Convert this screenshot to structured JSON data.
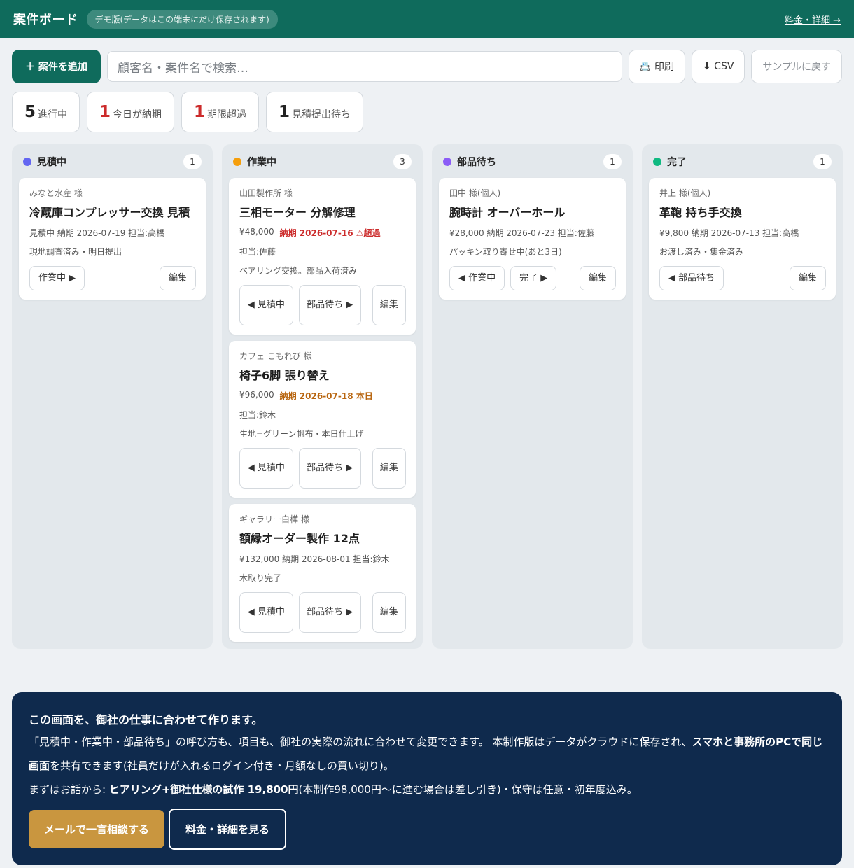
{
  "header": {
    "title": "案件ボード",
    "demo_badge": "デモ版(データはこの端末にだけ保存されます)",
    "pricing_link": "料金・詳細 →"
  },
  "toolbar": {
    "add_label": "＋ 案件を追加",
    "search_placeholder": "顧客名・案件名で検索…",
    "print_label": "印刷",
    "print_icon": "📇",
    "csv_label": "⬇ CSV",
    "sample_label": "サンプルに戻す"
  },
  "stats": [
    {
      "num": "5",
      "label": "進行中",
      "color": "#222222"
    },
    {
      "num": "1",
      "label": "今日が納期",
      "color": "#cc2b2b"
    },
    {
      "num": "1",
      "label": "期限超過",
      "color": "#cc2b2b"
    },
    {
      "num": "1",
      "label": "見積提出待ち",
      "color": "#222222"
    }
  ],
  "columns": [
    {
      "name": "見積中",
      "count": "1",
      "dot_color": "#6366f1",
      "cards": [
        {
          "customer": "みなと水産 様",
          "title": "冷蔵庫コンプレッサー交換 見積",
          "meta": "見積中 納期 2026-07-19 担当:高橋",
          "note": "現地調査済み・明日提出",
          "next": "作業中 ▶",
          "edit": "編集"
        }
      ]
    },
    {
      "name": "作業中",
      "count": "3",
      "dot_color": "#f59e0b",
      "cards": [
        {
          "customer": "山田製作所 様",
          "title": "三相モーター 分解修理",
          "price": "¥48,000",
          "due": "納期 2026-07-16 ⚠超過",
          "assignee": "担当:佐藤",
          "note": "ベアリング交換。部品入荷済み",
          "prev": "◀ 見積中",
          "next": "部品待ち ▶",
          "edit": "編集"
        },
        {
          "customer": "カフェ こもれび 様",
          "title": "椅子6脚 張り替え",
          "price": "¥96,000",
          "due": "納期 2026-07-18 本日",
          "assignee": "担当:鈴木",
          "note": "生地=グリーン帆布・本日仕上げ",
          "prev": "◀ 見積中",
          "next": "部品待ち ▶",
          "edit": "編集"
        },
        {
          "customer": "ギャラリー白樺 様",
          "title": "額縁オーダー製作 12点",
          "meta": "¥132,000 納期 2026-08-01 担当:鈴木",
          "note": "木取り完了",
          "prev": "◀ 見積中",
          "next": "部品待ち ▶",
          "edit": "編集"
        }
      ]
    },
    {
      "name": "部品待ち",
      "count": "1",
      "dot_color": "#8b5cf6",
      "cards": [
        {
          "customer": "田中 様(個人)",
          "title": "腕時計 オーバーホール",
          "meta": "¥28,000 納期 2026-07-23 担当:佐藤",
          "note": "パッキン取り寄せ中(あと3日)",
          "prev": "◀ 作業中",
          "next": "完了 ▶",
          "edit": "編集"
        }
      ]
    },
    {
      "name": "完了",
      "count": "1",
      "dot_color": "#10b981",
      "cards": [
        {
          "customer": "井上 様(個人)",
          "title": "革鞄 持ち手交換",
          "meta": "¥9,800 納期 2026-07-13 担当:高橋",
          "note": "お渡し済み・集金済み",
          "prev": "◀ 部品待ち",
          "edit": "編集"
        }
      ]
    }
  ],
  "cta": {
    "headline": "この画面を、御社の仕事に合わせて作ります。",
    "line1_a": "「見積中・作業中・部品待ち」の呼び方も、項目も、御社の実際の流れに合わせて変更できます。 本制作版はデータがクラウドに保存され、",
    "line1_b": "スマホと事務所のPCで同じ画面",
    "line1_c": "を共有できます(社員だけが入れるログイン付き・月額なしの買い切り)。",
    "line2_a": "まずはお話から: ",
    "line2_b": "ヒアリング+御社仕様の試作 19,800円",
    "line2_c": "(本制作98,000円〜に進む場合は差し引き)・保守は任意・初年度込み。",
    "mail_button": "メールで一言相談する",
    "detail_button": "料金・詳細を見る"
  }
}
